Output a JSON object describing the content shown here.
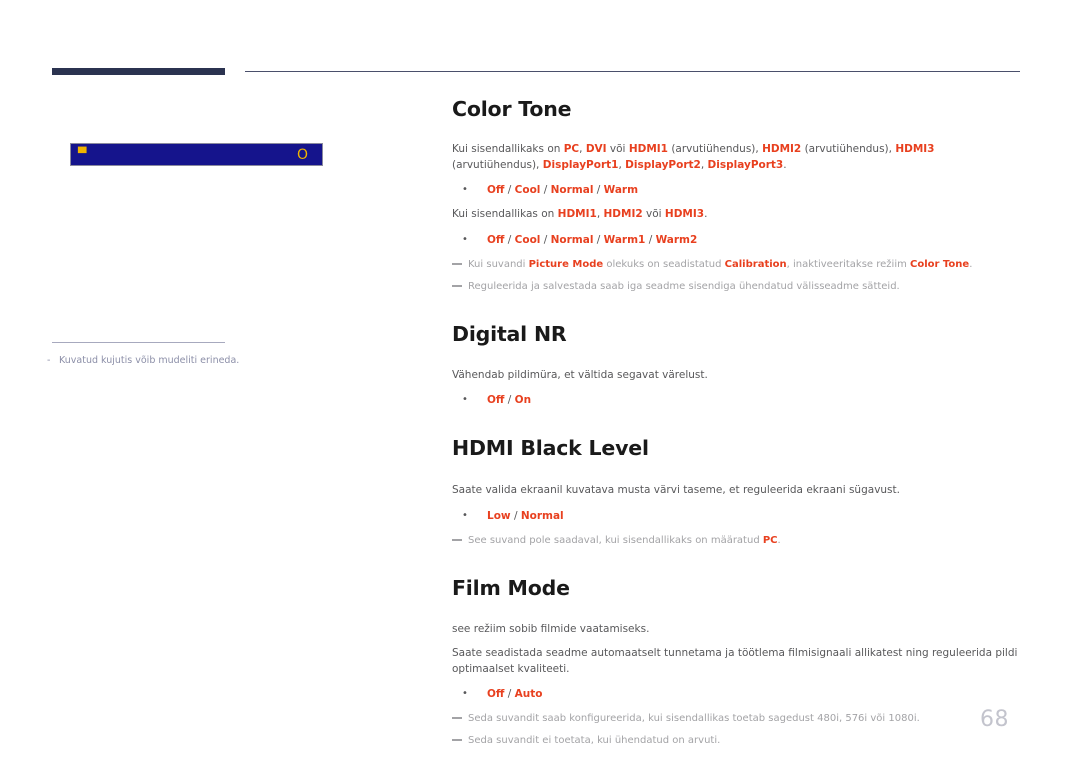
{
  "page": {
    "number": "68",
    "language": "et",
    "accent_color": "#e8401f",
    "header_bar_color": "#2b3350",
    "osd_bar_color": "#15148c",
    "osd_text_color": "#f0b400",
    "note_color": "#a3a3a6",
    "body_color": "#58585a"
  },
  "left_column": {
    "osd_menu": {
      "left_icon": "osd-lock-icon",
      "left_icon_glyph": "▀",
      "right_icon": "osd-circle-icon",
      "right_icon_glyph": "O"
    },
    "footnote": {
      "dash": "-",
      "text": "Kuvatud kujutis võib mudeliti erineda."
    }
  },
  "sections": [
    {
      "id": "color-tone",
      "title": "Color Tone",
      "blocks": [
        {
          "type": "rich-paragraph",
          "parts": [
            {
              "t": "Kui sisendallikaks on ",
              "hl": false
            },
            {
              "t": "PC",
              "hl": true
            },
            {
              "t": ", ",
              "hl": false
            },
            {
              "t": "DVI",
              "hl": true
            },
            {
              "t": " või ",
              "hl": false
            },
            {
              "t": "HDMI1",
              "hl": true
            },
            {
              "t": " (arvutiühendus), ",
              "hl": false
            },
            {
              "t": "HDMI2",
              "hl": true
            },
            {
              "t": " (arvutiühendus), ",
              "hl": false
            },
            {
              "t": "HDMI3",
              "hl": true
            },
            {
              "t": " (arvutiühendus), ",
              "hl": false
            },
            {
              "t": "DisplayPort1",
              "hl": true
            },
            {
              "t": ", ",
              "hl": false
            },
            {
              "t": "DisplayPort2",
              "hl": true
            },
            {
              "t": ", ",
              "hl": false
            },
            {
              "t": "DisplayPort3",
              "hl": true
            },
            {
              "t": ".",
              "hl": false
            }
          ]
        },
        {
          "type": "options",
          "bullet": "•",
          "options": [
            "Off",
            "Cool",
            "Normal",
            "Warm"
          ],
          "separator": " / "
        },
        {
          "type": "rich-paragraph",
          "parts": [
            {
              "t": "Kui sisendallikas on ",
              "hl": false
            },
            {
              "t": "HDMI1",
              "hl": true
            },
            {
              "t": ", ",
              "hl": false
            },
            {
              "t": "HDMI2",
              "hl": true
            },
            {
              "t": " või ",
              "hl": false
            },
            {
              "t": "HDMI3",
              "hl": true
            },
            {
              "t": ".",
              "hl": false
            }
          ]
        },
        {
          "type": "options",
          "bullet": "•",
          "options": [
            "Off",
            "Cool",
            "Normal",
            "Warm1",
            "Warm2"
          ],
          "separator": " / "
        },
        {
          "type": "note",
          "parts": [
            {
              "t": "Kui suvandi ",
              "hl": false
            },
            {
              "t": "Picture Mode",
              "hl": true
            },
            {
              "t": " olekuks on seadistatud ",
              "hl": false
            },
            {
              "t": "Calibration",
              "hl": true
            },
            {
              "t": ", inaktiveeritakse režiim ",
              "hl": false
            },
            {
              "t": "Color Tone",
              "hl": true
            },
            {
              "t": ".",
              "hl": false
            }
          ]
        },
        {
          "type": "note",
          "parts": [
            {
              "t": "Reguleerida ja salvestada saab iga seadme sisendiga ühendatud välisseadme sätteid.",
              "hl": false
            }
          ]
        }
      ]
    },
    {
      "id": "digital-nr",
      "title": "Digital NR",
      "blocks": [
        {
          "type": "rich-paragraph",
          "parts": [
            {
              "t": "Vähendab pildimüra, et vältida segavat värelust.",
              "hl": false
            }
          ]
        },
        {
          "type": "options",
          "bullet": "•",
          "options": [
            "Off",
            "On"
          ],
          "separator": " / "
        }
      ]
    },
    {
      "id": "hdmi-black-level",
      "title": "HDMI Black Level",
      "blocks": [
        {
          "type": "rich-paragraph",
          "parts": [
            {
              "t": "Saate valida ekraanil kuvatava musta värvi taseme, et reguleerida ekraani sügavust.",
              "hl": false
            }
          ]
        },
        {
          "type": "options",
          "bullet": "•",
          "options": [
            "Low",
            "Normal"
          ],
          "separator": " / "
        },
        {
          "type": "note",
          "parts": [
            {
              "t": "See suvand pole saadaval, kui sisendallikaks on määratud ",
              "hl": false
            },
            {
              "t": "PC",
              "hl": true
            },
            {
              "t": ".",
              "hl": false
            }
          ]
        }
      ]
    },
    {
      "id": "film-mode",
      "title": "Film Mode",
      "blocks": [
        {
          "type": "rich-paragraph",
          "parts": [
            {
              "t": "see režiim sobib filmide vaatamiseks.",
              "hl": false
            }
          ]
        },
        {
          "type": "rich-paragraph",
          "parts": [
            {
              "t": "Saate seadistada seadme automaatselt tunnetama ja töötlema filmisignaali allikatest ning reguleerida pildi optimaalset kvaliteeti.",
              "hl": false
            }
          ]
        },
        {
          "type": "options",
          "bullet": "•",
          "options": [
            "Off",
            "Auto"
          ],
          "separator": " / "
        },
        {
          "type": "note",
          "parts": [
            {
              "t": "Seda suvandit saab konfigureerida, kui sisendallikas toetab sagedust 480i, 576i või 1080i.",
              "hl": false
            }
          ]
        },
        {
          "type": "note",
          "parts": [
            {
              "t": "Seda suvandit ei toetata, kui ühendatud on arvuti.",
              "hl": false
            }
          ]
        }
      ]
    }
  ]
}
